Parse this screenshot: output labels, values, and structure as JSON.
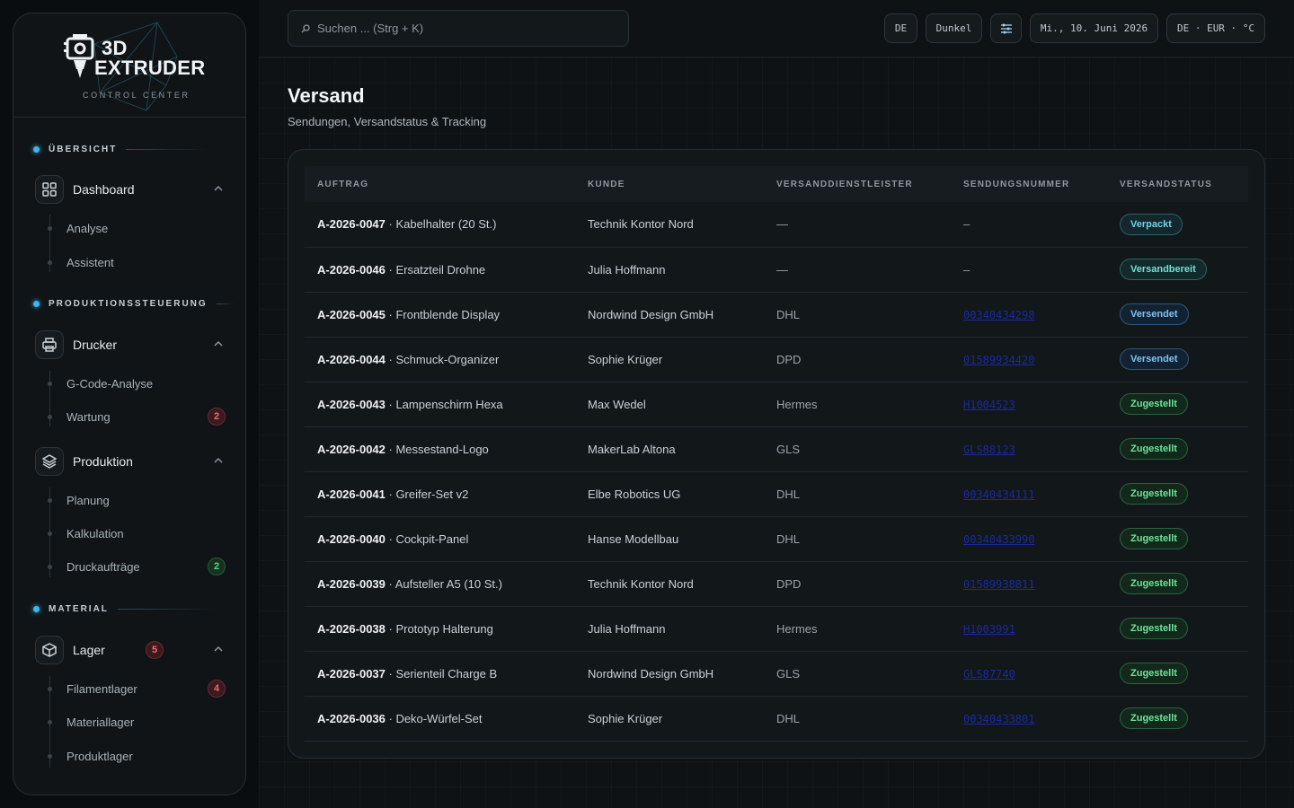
{
  "brand": {
    "line1": "3D",
    "line2": "EXTRUDER",
    "line3": "CONTROL CENTER"
  },
  "sidebar": {
    "sections": [
      {
        "label": "ÜBERSICHT"
      },
      {
        "label": "PRODUKTIONSSTEUERUNG"
      },
      {
        "label": "MATERIAL"
      }
    ],
    "groups": {
      "dashboard": {
        "label": "Dashboard",
        "items": [
          "Analyse",
          "Assistent"
        ]
      },
      "drucker": {
        "label": "Drucker",
        "items": [
          "G-Code-Analyse",
          "Wartung"
        ],
        "badges": {
          "wartung": "2"
        }
      },
      "produktion": {
        "label": "Produktion",
        "items": [
          "Planung",
          "Kalkulation",
          "Druckaufträge"
        ],
        "badges": {
          "druckauftraege": "2"
        }
      },
      "lager": {
        "label": "Lager",
        "badge": "5",
        "items": [
          "Filamentlager",
          "Materiallager",
          "Produktlager"
        ],
        "badges": {
          "filamentlager": "4"
        }
      }
    }
  },
  "topbar": {
    "search_placeholder": "Suchen ... (Strg + K)",
    "lang": "DE",
    "theme": "Dunkel",
    "date": "Mi., 10. Juni 2026",
    "locale": "DE · EUR · °C"
  },
  "page": {
    "title": "Versand",
    "subtitle": "Sendungen, Versandstatus & Tracking"
  },
  "table": {
    "headers": [
      "AUFTRAG",
      "KUNDE",
      "VERSANDDIENSTLEISTER",
      "SENDUNGSNUMMER",
      "VERSANDSTATUS"
    ],
    "rows": [
      {
        "id": "A-2026-0047",
        "desc": " · Kabelhalter (20 St.)",
        "customer": "Technik Kontor Nord",
        "carrier": "—",
        "tracking": "–",
        "status": "Verpackt"
      },
      {
        "id": "A-2026-0046",
        "desc": " · Ersatzteil Drohne",
        "customer": "Julia Hoffmann",
        "carrier": "—",
        "tracking": "–",
        "status": "Versandbereit"
      },
      {
        "id": "A-2026-0045",
        "desc": " · Frontblende Display",
        "customer": "Nordwind Design GmbH",
        "carrier": "DHL",
        "tracking": "00340434298",
        "status": "Versendet"
      },
      {
        "id": "A-2026-0044",
        "desc": " · Schmuck-Organizer",
        "customer": "Sophie Krüger",
        "carrier": "DPD",
        "tracking": "01589934420",
        "status": "Versendet"
      },
      {
        "id": "A-2026-0043",
        "desc": " · Lampenschirm Hexa",
        "customer": "Max Wedel",
        "carrier": "Hermes",
        "tracking": "H1004523",
        "status": "Zugestellt"
      },
      {
        "id": "A-2026-0042",
        "desc": " · Messestand-Logo",
        "customer": "MakerLab Altona",
        "carrier": "GLS",
        "tracking": "GLS88123",
        "status": "Zugestellt"
      },
      {
        "id": "A-2026-0041",
        "desc": " · Greifer-Set v2",
        "customer": "Elbe Robotics UG",
        "carrier": "DHL",
        "tracking": "00340434111",
        "status": "Zugestellt"
      },
      {
        "id": "A-2026-0040",
        "desc": " · Cockpit-Panel",
        "customer": "Hanse Modellbau",
        "carrier": "DHL",
        "tracking": "00340433990",
        "status": "Zugestellt"
      },
      {
        "id": "A-2026-0039",
        "desc": " · Aufsteller A5 (10 St.)",
        "customer": "Technik Kontor Nord",
        "carrier": "DPD",
        "tracking": "01589938811",
        "status": "Zugestellt"
      },
      {
        "id": "A-2026-0038",
        "desc": " · Prototyp Halterung",
        "customer": "Julia Hoffmann",
        "carrier": "Hermes",
        "tracking": "H1003991",
        "status": "Zugestellt"
      },
      {
        "id": "A-2026-0037",
        "desc": " · Serienteil Charge B",
        "customer": "Nordwind Design GmbH",
        "carrier": "GLS",
        "tracking": "GLS87740",
        "status": "Zugestellt"
      },
      {
        "id": "A-2026-0036",
        "desc": " · Deko-Würfel-Set",
        "customer": "Sophie Krüger",
        "carrier": "DHL",
        "tracking": "00340433801",
        "status": "Zugestellt"
      }
    ]
  },
  "colors": {
    "accent": "#3fb6f0",
    "badge_red": "#ef6a72",
    "badge_green": "#58d68a",
    "status_done": "#6ee29a",
    "status_sent": "#7cc4f2"
  }
}
